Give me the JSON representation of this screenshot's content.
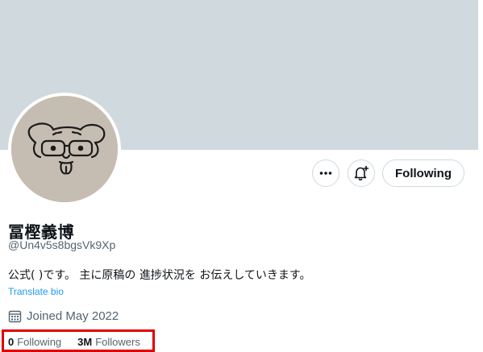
{
  "profile": {
    "display_name": "冨樫義博",
    "handle": "@Un4v5s8bgsVk9Xp",
    "bio": "公式( )です。 主に原稿の 進捗状況を お伝えしていきます。",
    "translate_label": "Translate bio",
    "joined": "Joined May 2022",
    "avatar_icon": "dog-glasses-drawing-icon"
  },
  "actions": {
    "more_icon": "more-horizontal-icon",
    "notify_icon": "bell-plus-icon",
    "following_label": "Following"
  },
  "stats": {
    "following_count": "0",
    "following_label": "Following",
    "followers_count": "3M",
    "followers_label": "Followers"
  },
  "colors": {
    "banner": "#cfd9de",
    "link": "#1d9bf0",
    "secondary_text": "#536471",
    "highlight_box": "#e00000"
  }
}
